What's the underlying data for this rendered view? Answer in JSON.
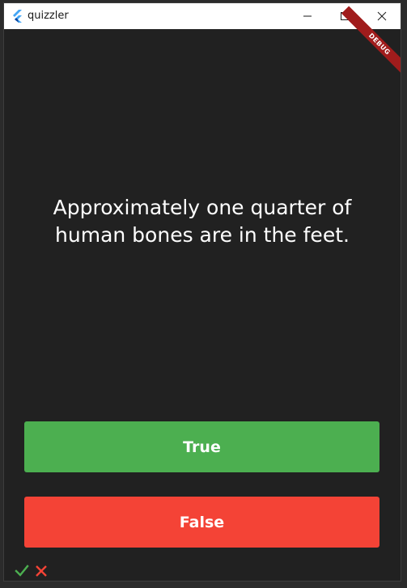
{
  "window": {
    "title": "quizzler",
    "controls": [
      "minimize",
      "maximize",
      "close"
    ]
  },
  "debug_banner": "DEBUG",
  "quiz": {
    "question": "Approximately one quarter of human bones are in the feet.",
    "true_label": "True",
    "false_label": "False",
    "true_color": "#4caf50",
    "false_color": "#f44336"
  },
  "score_keeper": [
    {
      "icon": "check-icon",
      "color": "#4caf50"
    },
    {
      "icon": "close-icon",
      "color": "#f44336"
    }
  ]
}
